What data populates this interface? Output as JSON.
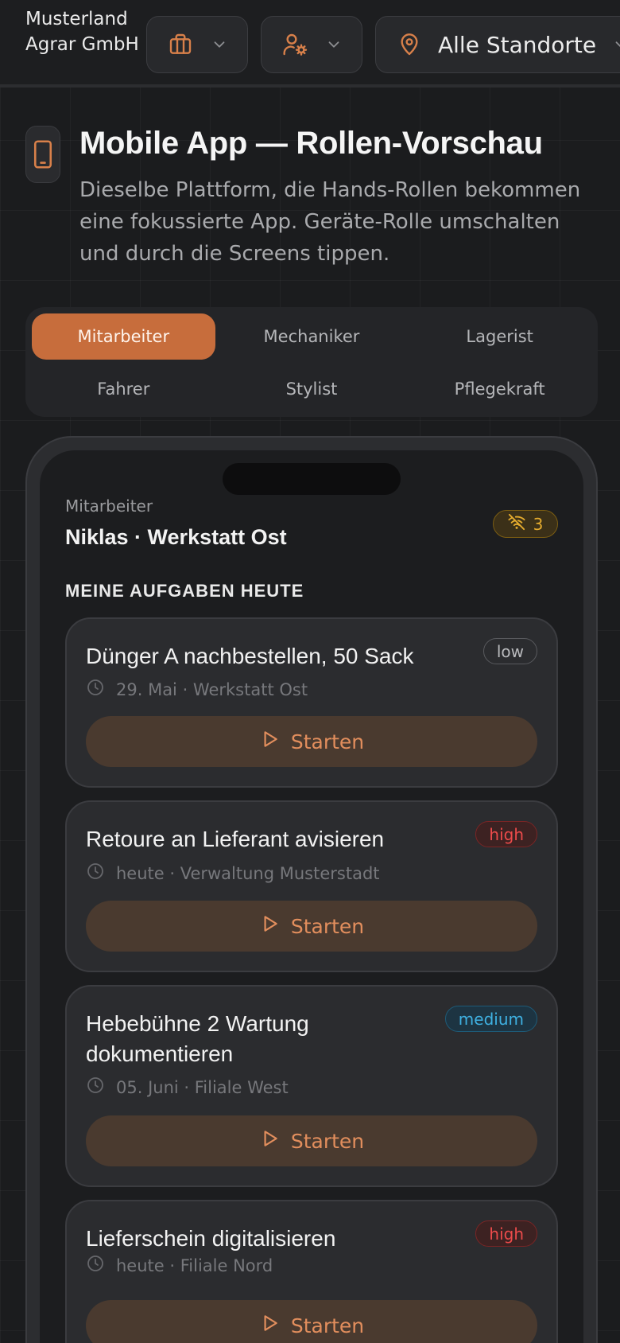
{
  "topbar": {
    "company_name": "Musterland Agrar GmbH",
    "business_icon": "briefcase-icon",
    "role_icon": "user-gear-icon",
    "location_icon": "map-pin-icon",
    "location_label": "Alle Standorte"
  },
  "header": {
    "icon": "smartphone-icon",
    "title": "Mobile App — Rollen-Vorschau",
    "subtitle": "Dieselbe Plattform, die Hands-Rollen bekommen eine fokussierte App. Geräte-Rolle umschalten und durch die Screens tippen."
  },
  "roles": {
    "active": "Mitarbeiter",
    "items": [
      {
        "label": "Mitarbeiter"
      },
      {
        "label": "Mechaniker"
      },
      {
        "label": "Lagerist"
      },
      {
        "label": "Fahrer"
      },
      {
        "label": "Stylist"
      },
      {
        "label": "Pflegekraft"
      }
    ]
  },
  "app": {
    "role_label": "Mitarbeiter",
    "user_label": "Niklas · Werkstatt Ost",
    "offline_count": "3",
    "offline_icon": "wifi-off-icon",
    "section_heading": "MEINE AUFGABEN HEUTE",
    "start_label": "Starten",
    "tasks": [
      {
        "title": "Dünger A nachbestellen, 50 Sack",
        "priority": "low",
        "meta": "29. Mai · Werkstatt Ost"
      },
      {
        "title": "Retoure an Lieferant avisieren",
        "priority": "high",
        "meta": "heute · Verwaltung Musterstadt"
      },
      {
        "title": "Hebebühne 2 Wartung dokumentieren",
        "priority": "medium",
        "meta": "05. Juni · Filiale West"
      },
      {
        "title": "Lieferschein digitalisieren",
        "priority": "high",
        "meta": "heute · Filiale Nord"
      }
    ]
  },
  "colors": {
    "accent": "#c76d3c",
    "background": "#1b1c1e",
    "card": "#2b2c2f",
    "priority_low": "#b9babd",
    "priority_high": "#ec4b4b",
    "priority_medium": "#3fb1e2",
    "offline": "#e4ab2e"
  }
}
